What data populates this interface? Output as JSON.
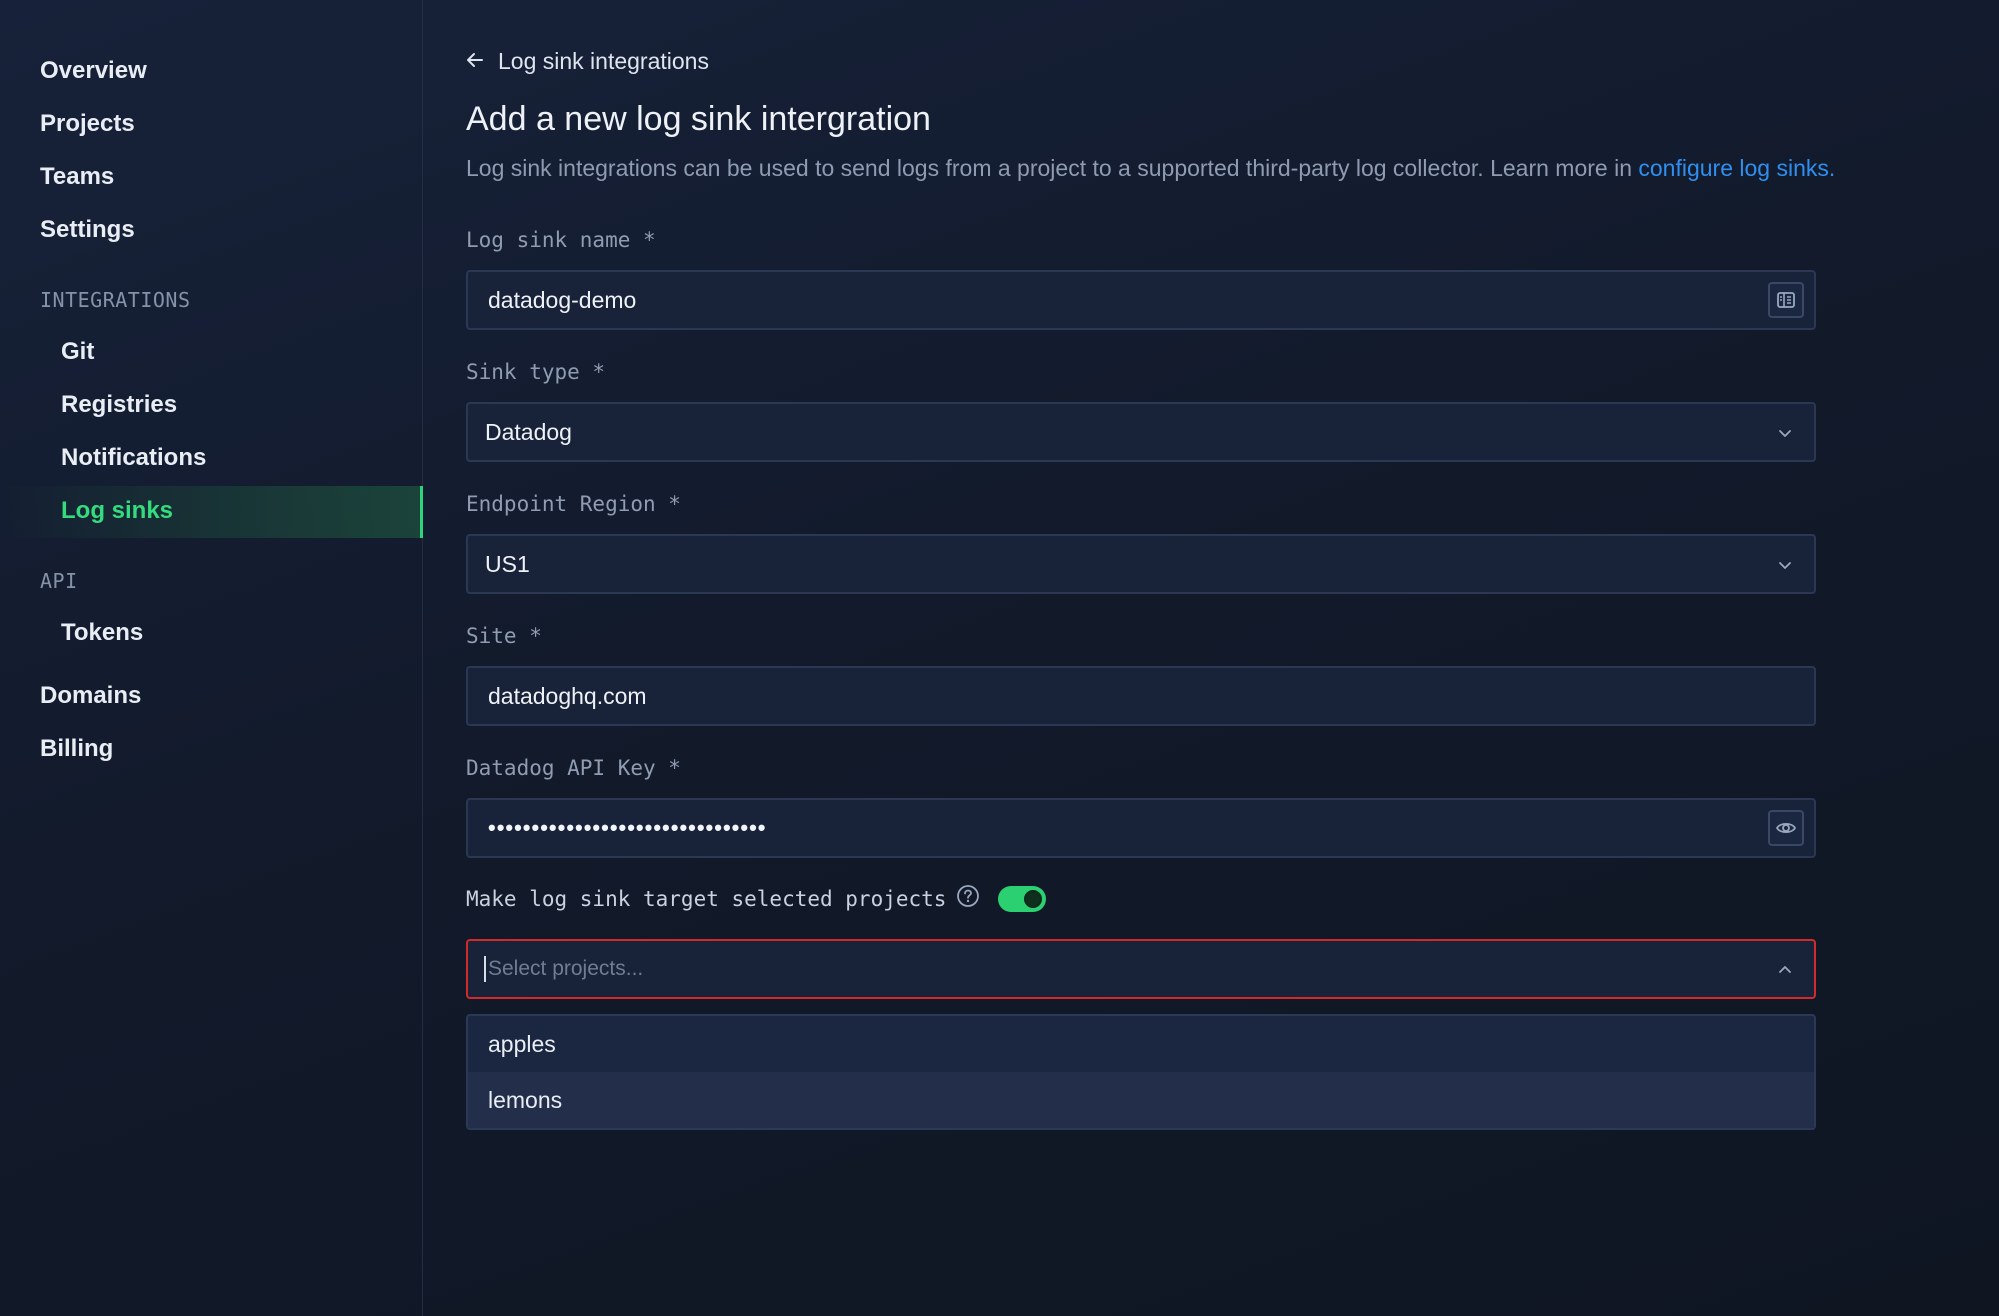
{
  "sidebar": {
    "items_top": [
      "Overview",
      "Projects",
      "Teams",
      "Settings"
    ],
    "integrations_label": "INTEGRATIONS",
    "integrations": [
      "Git",
      "Registries",
      "Notifications",
      "Log sinks"
    ],
    "active_item": "Log sinks",
    "api_label": "API",
    "api_items": [
      "Tokens"
    ],
    "items_bottom": [
      "Domains",
      "Billing"
    ]
  },
  "header": {
    "back_label": "Log sink integrations",
    "title": "Add a new log sink intergration",
    "description": "Log sink integrations can be used to send logs from a project to a supported third-party log collector. Learn more in ",
    "description_link": "configure log sinks."
  },
  "form": {
    "name_label": "Log sink name *",
    "name_value": "datadog-demo",
    "sink_type_label": "Sink type *",
    "sink_type_value": "Datadog",
    "region_label": "Endpoint Region *",
    "region_value": "US1",
    "site_label": "Site *",
    "site_value": "datadoghq.com",
    "api_key_label": "Datadog API Key *",
    "api_key_masked": "••••••••••••••••••••••••••••••••",
    "target_projects_label": "Make log sink target selected projects",
    "target_projects_enabled": true,
    "projects_placeholder": "Select projects...",
    "project_options": [
      "apples",
      "lemons"
    ]
  },
  "colors": {
    "accent_green": "#2ed47a",
    "link_blue": "#2f8ff0",
    "error_red": "#d12a2a"
  }
}
